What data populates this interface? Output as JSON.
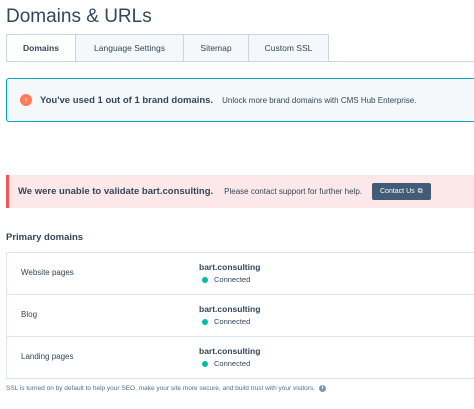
{
  "page": {
    "title": "Domains & URLs"
  },
  "tabs": [
    {
      "label": "Domains",
      "active": true
    },
    {
      "label": "Language Settings",
      "active": false
    },
    {
      "label": "Sitemap",
      "active": false
    },
    {
      "label": "Custom SSL",
      "active": false
    }
  ],
  "brand_alert": {
    "icon": "exclamation-icon",
    "title": "You've used 1 out of 1 brand domains.",
    "text": "Unlock more brand domains with CMS Hub Enterprise."
  },
  "error_alert": {
    "title": "We were unable to validate bart.consulting.",
    "text": "Please contact support for further help.",
    "button_label": "Contact Us",
    "button_icon": "external-link-icon"
  },
  "primary_domains": {
    "title": "Primary domains",
    "rows": [
      {
        "label": "Website pages",
        "domain": "bart.consulting",
        "status": "Connected"
      },
      {
        "label": "Blog",
        "domain": "bart.consulting",
        "status": "Connected"
      },
      {
        "label": "Landing pages",
        "domain": "bart.consulting",
        "status": "Connected"
      }
    ]
  },
  "footnote": {
    "text": "SSL is turned on by default to help your SEO, make your site more secure, and build trust with your visitors.",
    "icon": "info-icon"
  },
  "colors": {
    "text": "#33475b",
    "accent_teal": "#00a4bd",
    "warning_orange": "#ff7a59",
    "error_red": "#f2545b",
    "error_bg": "#fde8e9",
    "button_dark": "#425b76",
    "connected_green": "#00bda5"
  }
}
